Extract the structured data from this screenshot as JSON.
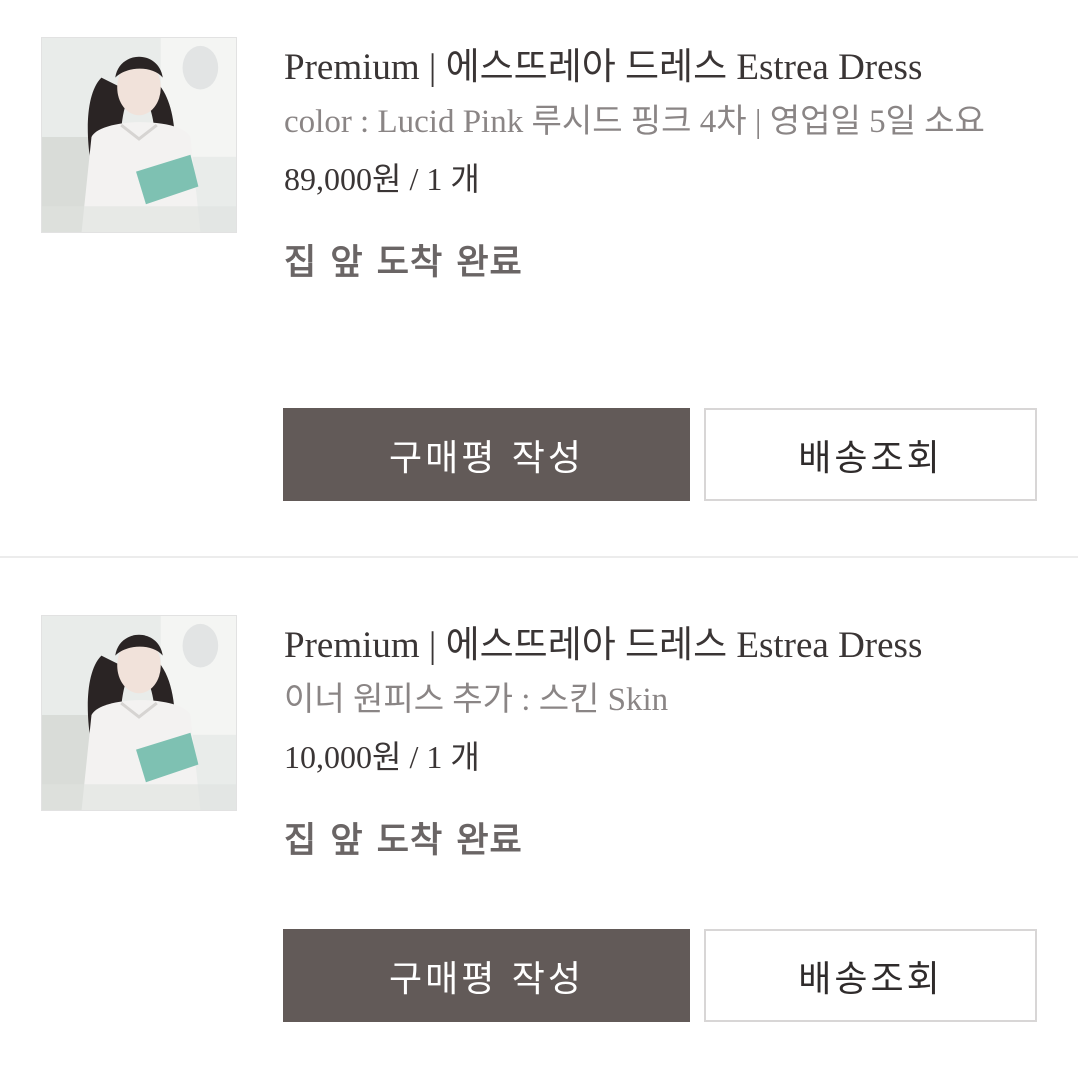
{
  "orders": [
    {
      "product_title": "Premium | 에스뜨레아 드레스 Estrea Dress",
      "option_text": "color : Lucid Pink 루시드 핑크 4차 | 영업일 5일 소요",
      "price_text": "89,000원 / 1 개",
      "status_text": "집 앞 도착 완료",
      "review_button": "구매평 작성",
      "tracking_button": "배송조회"
    },
    {
      "product_title": "Premium | 에스뜨레아 드레스 Estrea Dress",
      "option_text": "이너 원피스 추가 : 스킨 Skin",
      "price_text": "10,000원 / 1 개",
      "status_text": "집 앞 도착 완료",
      "review_button": "구매평 작성",
      "tracking_button": "배송조회"
    }
  ],
  "colors": {
    "primary_button": "#625a58",
    "status_text": "#6a6565",
    "option_text": "#8a8585"
  },
  "icons": [
    "product-thumbnail"
  ]
}
